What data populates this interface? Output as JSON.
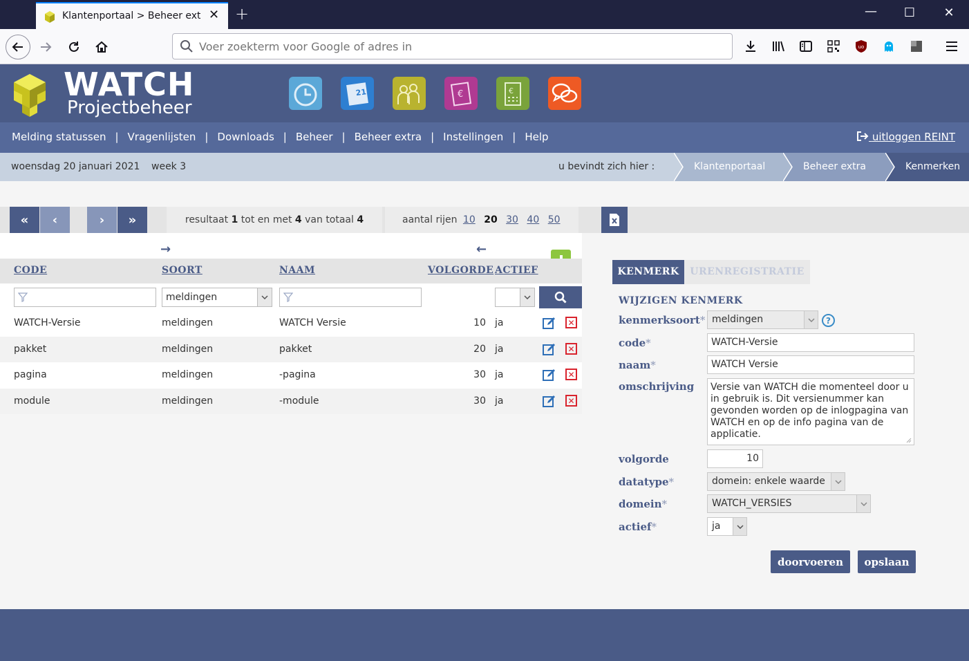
{
  "browser": {
    "tab_title": "Klantenportaal > Beheer extra",
    "new_tab_symbol": "+",
    "close_symbol": "✕",
    "url_placeholder": "Voer zoekterm voor Google of adres in",
    "window_controls": {
      "minimize": "—",
      "maximize": "☐",
      "close": "✕"
    }
  },
  "app": {
    "brand": "WATCH",
    "brand_sub": "Projectbeheer",
    "module_icons": [
      {
        "name": "clock-module-icon",
        "color": "#5ba8d8"
      },
      {
        "name": "calendar-module-icon",
        "color": "#2e7fd1"
      },
      {
        "name": "people-module-icon",
        "color": "#b9b32f"
      },
      {
        "name": "invoice-module-icon",
        "color": "#b03a92"
      },
      {
        "name": "calculator-module-icon",
        "color": "#7aa33b"
      },
      {
        "name": "chat-module-icon",
        "color": "#ee5a24"
      }
    ]
  },
  "menu": {
    "items": [
      "Melding statussen",
      "Vragenlijsten",
      "Downloads",
      "Beheer",
      "Beheer extra",
      "Instellingen",
      "Help"
    ],
    "separator": "|",
    "logout": "uitloggen REINT"
  },
  "infobar": {
    "date": "woensdag 20 januari 2021",
    "week": "week 3",
    "here_label": "u bevindt zich hier :",
    "breadcrumbs": [
      "Klantenportaal",
      "Beheer extra",
      "Kenmerken"
    ]
  },
  "pager": {
    "first": "«",
    "prev": "‹",
    "next": "›",
    "last": "»",
    "result_prefix": "resultaat",
    "result_from": "1",
    "result_mid": "tot en met",
    "result_to": "4",
    "result_total_label": "van totaal",
    "result_total": "4",
    "rows_label": "aantal rijen",
    "row_options": [
      "10",
      "20",
      "30",
      "40",
      "50"
    ],
    "current_rows": "20"
  },
  "table": {
    "headers": {
      "code": "CODE",
      "soort": "SOORT",
      "naam": "NAAM",
      "volgorde": "VOLGORDE",
      "actief": "ACTIEF"
    },
    "filters": {
      "code": "",
      "soort": "meldingen",
      "naam": "",
      "actief": ""
    },
    "rows": [
      {
        "code": "WATCH-Versie",
        "soort": "meldingen",
        "naam": "WATCH Versie",
        "volgorde": "10",
        "actief": "ja"
      },
      {
        "code": "pakket",
        "soort": "meldingen",
        "naam": "pakket",
        "volgorde": "20",
        "actief": "ja"
      },
      {
        "code": "pagina",
        "soort": "meldingen",
        "naam": "-pagina",
        "volgorde": "30",
        "actief": "ja"
      },
      {
        "code": "module",
        "soort": "meldingen",
        "naam": "-module",
        "volgorde": "30",
        "actief": "ja"
      }
    ]
  },
  "form": {
    "tabs": [
      "KENMERK",
      "URENREGISTRATIE"
    ],
    "title": "WIJZIGEN KENMERK",
    "required_mark": "*",
    "labels": {
      "kenmerksoort": "kenmerksoort",
      "code": "code",
      "naam": "naam",
      "omschrijving": "omschrijving",
      "volgorde": "volgorde",
      "datatype": "datatype",
      "domein": "domein",
      "actief": "actief"
    },
    "values": {
      "kenmerksoort": "meldingen",
      "code": "WATCH-Versie",
      "naam": "WATCH Versie",
      "omschrijving": "Versie van WATCH die momenteel door u in gebruik is. Dit versienummer kan gevonden worden op de inlogpagina van WATCH en op de info pagina van de applicatie.",
      "volgorde": "10",
      "datatype": "domein: enkele waarde",
      "domein": "WATCH_VERSIES",
      "actief": "ja"
    },
    "help_symbol": "?",
    "buttons": {
      "doorvoeren": "doorvoeren",
      "opslaan": "opslaan"
    }
  },
  "colors": {
    "primary": "#4a5b87",
    "menu": "#55699a",
    "infobar": "#c7d2e0",
    "add_green": "#8dc63f",
    "delete_red": "#d9232d"
  }
}
